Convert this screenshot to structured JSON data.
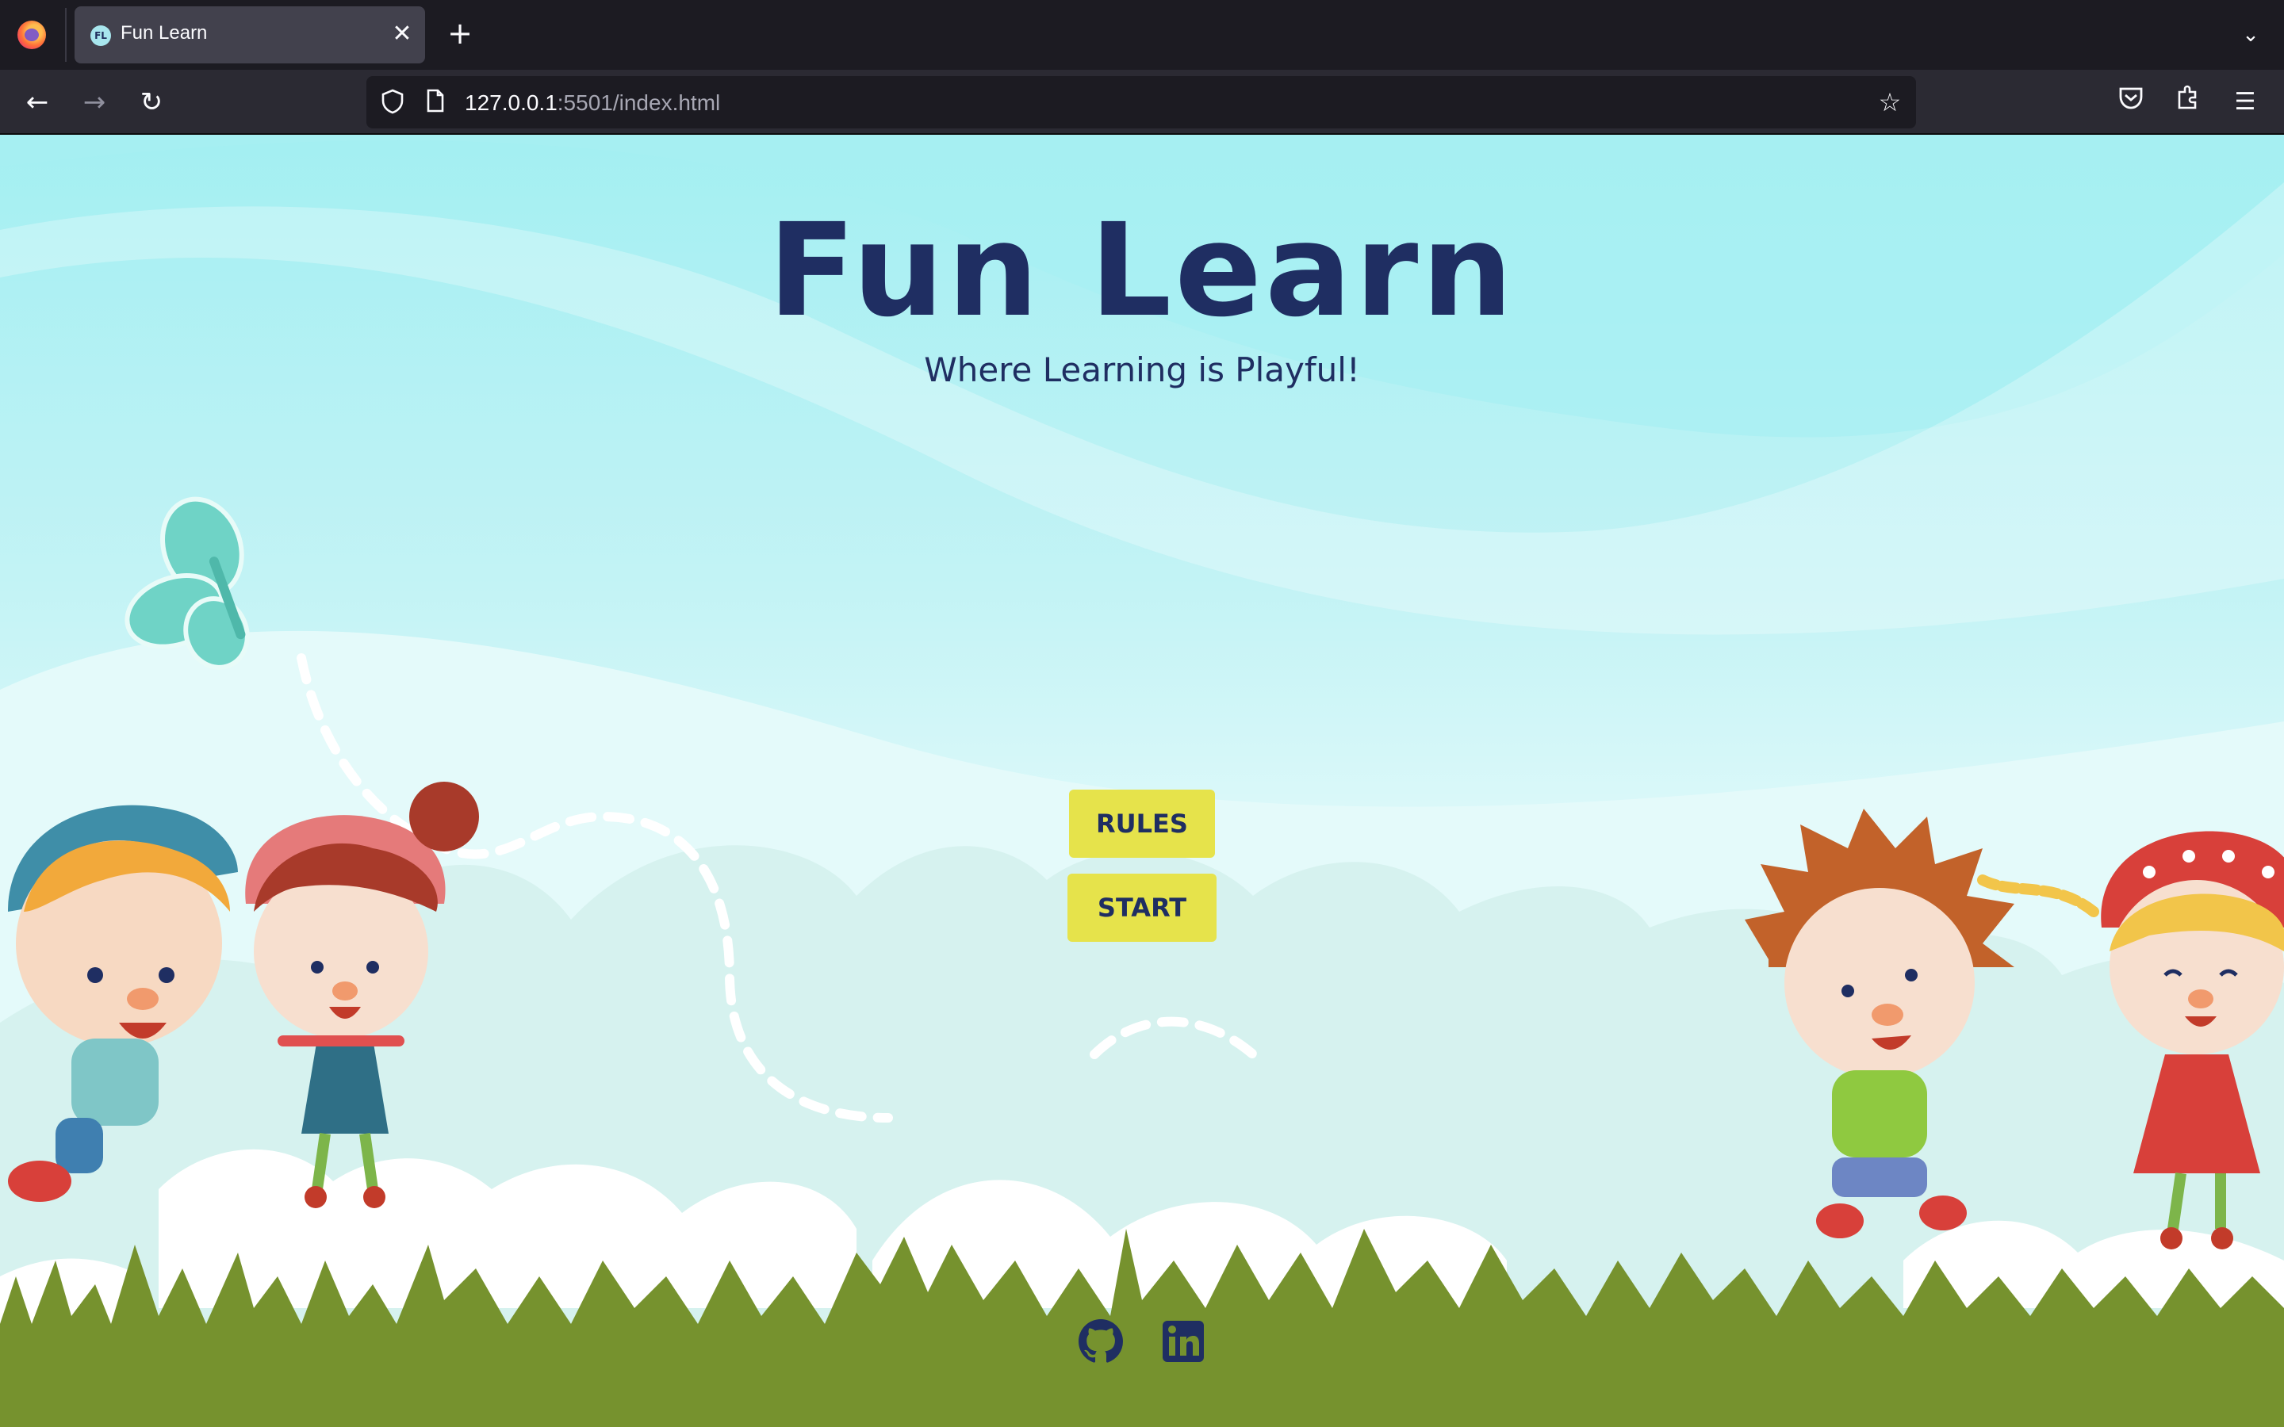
{
  "browser": {
    "tab_title": "Fun Learn",
    "tab_favicon_text": "FL",
    "url_host": "127.0.0.1",
    "url_rest": ":5501/index.html"
  },
  "icons": {
    "back": "back-arrow-icon",
    "forward": "forward-arrow-icon",
    "reload": "reload-icon",
    "bookmark": "star-icon",
    "pocket": "pocket-icon",
    "extensions": "puzzle-icon",
    "menu": "hamburger-menu-icon",
    "github": "github-icon",
    "linkedin": "linkedin-icon"
  },
  "page": {
    "title": "Fun Learn",
    "subtitle": "Where Learning is Playful!",
    "rules_label": "RULES",
    "start_label": "START"
  },
  "colors": {
    "title": "#1f2e62",
    "button_bg": "#e6e34b",
    "grass": "#76922e",
    "sky_top": "#a3eff2"
  }
}
